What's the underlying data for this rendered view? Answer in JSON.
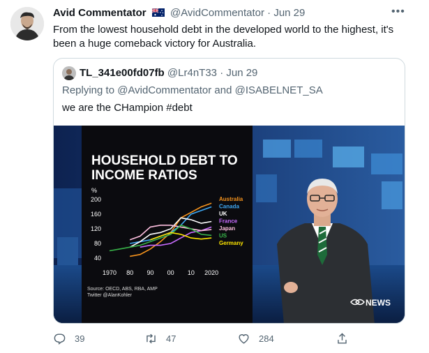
{
  "tweet": {
    "author_name": "Avid Commentator",
    "author_handle": "@AvidCommentator",
    "separator": "·",
    "date": "Jun 29",
    "flag_icon": "australian-flag-icon",
    "more_label": "•••",
    "text": "From the lowest household debt in the developed world to the highest, it's been a huge comeback victory for Australia."
  },
  "quote": {
    "author_name": "TL_341e00fd07fb",
    "author_handle": "@Lr4nT33",
    "separator": "·",
    "date": "Jun 29",
    "reply_prefix": "Replying to",
    "reply_mention_1": "@AvidCommentator",
    "reply_and": "and",
    "reply_mention_2": "@ISABELNET_SA",
    "text": "we are the CHampion #debt"
  },
  "media": {
    "title_line_1": "HOUSEHOLD DEBT TO",
    "title_line_2": "INCOME RATIOS",
    "source_line_1": "Source: OECD, ABS, RBA, AMP",
    "source_line_2": "Twitter @AlanKohler",
    "broadcaster": "ABC NEWS",
    "broadcaster_icon": "abc-logo-icon"
  },
  "chart_data": {
    "type": "line",
    "title": "HOUSEHOLD DEBT TO INCOME RATIOS",
    "ylabel": "%",
    "x": [
      1970,
      1975,
      1980,
      1985,
      1990,
      1995,
      2000,
      2005,
      2010,
      2015,
      2020
    ],
    "x_tick_labels": [
      "1970",
      "80",
      "90",
      "00",
      "10",
      "2020"
    ],
    "y_tick_labels": [
      "200",
      "160",
      "120",
      "80",
      "40"
    ],
    "ylim": [
      40,
      200
    ],
    "xlim": [
      1970,
      2022
    ],
    "series": [
      {
        "name": "Australia",
        "color": "#f7941d",
        "values": [
          null,
          null,
          45,
          50,
          65,
          85,
          110,
          150,
          165,
          180,
          190
        ]
      },
      {
        "name": "Canada",
        "color": "#3fa9f5",
        "values": [
          null,
          null,
          80,
          85,
          90,
          100,
          110,
          130,
          160,
          170,
          180
        ]
      },
      {
        "name": "UK",
        "color": "#ffffff",
        "values": [
          null,
          null,
          70,
          85,
          105,
          110,
          120,
          150,
          145,
          135,
          140
        ]
      },
      {
        "name": "France",
        "color": "#c86cff",
        "values": [
          null,
          null,
          null,
          70,
          75,
          75,
          80,
          95,
          110,
          115,
          125
        ]
      },
      {
        "name": "Japan",
        "color": "#ffc0e0",
        "values": [
          null,
          null,
          90,
          100,
          125,
          130,
          130,
          125,
          120,
          115,
          118
        ]
      },
      {
        "name": "US",
        "color": "#39b54a",
        "values": [
          60,
          65,
          70,
          75,
          85,
          95,
          105,
          130,
          120,
          105,
          102
        ]
      },
      {
        "name": "Germany",
        "color": "#ffe600",
        "values": [
          null,
          null,
          null,
          null,
          90,
          100,
          110,
          105,
          95,
          92,
          95
        ]
      }
    ],
    "grid": false,
    "legend": "right"
  },
  "actions": {
    "reply_count": "39",
    "retweet_count": "47",
    "like_count": "284",
    "reply_icon": "reply-icon",
    "retweet_icon": "retweet-icon",
    "like_icon": "heart-icon",
    "share_icon": "share-icon"
  }
}
